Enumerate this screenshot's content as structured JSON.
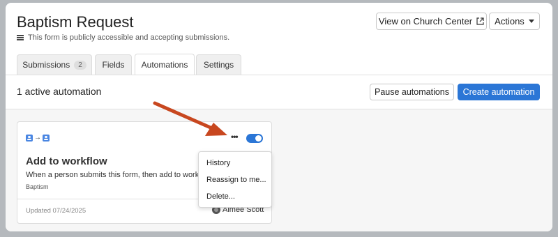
{
  "page": {
    "title": "Baptism Request",
    "subtitle": "This form is publicly accessible and accepting submissions."
  },
  "header": {
    "view_label": "View on Church Center",
    "actions_label": "Actions"
  },
  "tabs": [
    {
      "label": "Submissions",
      "badge": "2"
    },
    {
      "label": "Fields"
    },
    {
      "label": "Automations",
      "active": true
    },
    {
      "label": "Settings"
    }
  ],
  "toolbar": {
    "count_text": "1 active automation",
    "pause_label": "Pause automations",
    "create_label": "Create automation"
  },
  "automation": {
    "title": "Add to workflow",
    "description": "When a person submits this form, then add to workflow",
    "tag": "Baptism",
    "updated": "Updated 07/24/2025",
    "person": "Aimee Scott",
    "enabled": true
  },
  "menu": {
    "items": [
      "History",
      "Reassign to me...",
      "Delete..."
    ]
  },
  "colors": {
    "accent": "#2b76d6",
    "annotation_arrow": "#c8471f"
  },
  "icons": [
    "list-icon",
    "external-link-icon",
    "caret-down-icon",
    "person-icon",
    "arrow-right-icon",
    "more-icon",
    "toggle-icon",
    "avatar-icon"
  ]
}
